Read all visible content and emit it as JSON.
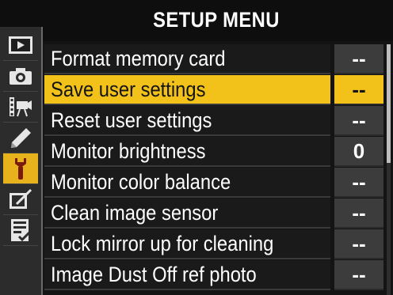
{
  "title": "SETUP MENU",
  "sidebar": {
    "tabs": [
      {
        "name": "playback-icon",
        "active": false
      },
      {
        "name": "camera-icon",
        "active": false
      },
      {
        "name": "movie-icon",
        "active": false
      },
      {
        "name": "pencil-icon",
        "active": false
      },
      {
        "name": "wrench-icon",
        "active": true
      },
      {
        "name": "retouch-icon",
        "active": false
      },
      {
        "name": "my-menu-icon",
        "active": false
      }
    ]
  },
  "menu": {
    "items": [
      {
        "label": "Format memory card",
        "value": "--",
        "selected": false
      },
      {
        "label": "Save user settings",
        "value": "--",
        "selected": true
      },
      {
        "label": "Reset user settings",
        "value": "--",
        "selected": false
      },
      {
        "label": "Monitor brightness",
        "value": "0",
        "selected": false
      },
      {
        "label": "Monitor color balance",
        "value": "--",
        "selected": false
      },
      {
        "label": "Clean image sensor",
        "value": "--",
        "selected": false
      },
      {
        "label": "Lock mirror up for cleaning",
        "value": "--",
        "selected": false
      },
      {
        "label": "Image Dust Off ref photo",
        "value": "--",
        "selected": false
      }
    ]
  },
  "colors": {
    "accent": "#f2c21a",
    "background": "#141414",
    "value_box": "#3c3c3c"
  }
}
